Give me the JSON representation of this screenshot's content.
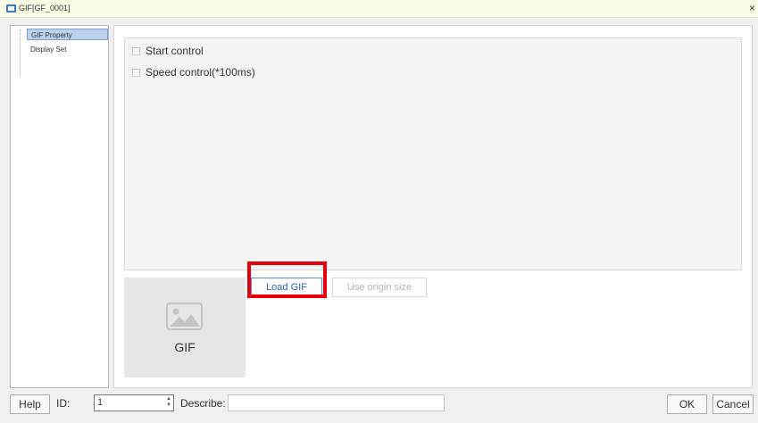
{
  "window": {
    "title": "GIF[GF_0001]",
    "close_glyph": "×"
  },
  "nav": {
    "items": [
      {
        "label": "GIF Property",
        "selected": true
      },
      {
        "label": "Display Set",
        "selected": false
      }
    ]
  },
  "options": {
    "start_control": "Start control",
    "speed_control": "Speed control(*100ms)"
  },
  "preview": {
    "label": "GIF",
    "icon": "image-icon"
  },
  "buttons": {
    "load_gif": "Load GIF",
    "use_origin_size": "Use origin size"
  },
  "footer": {
    "help": "Help",
    "id_label": "ID:",
    "id_value": "1",
    "describe_label": "Describe:",
    "describe_value": "",
    "ok": "OK",
    "cancel": "Cancel"
  },
  "colors": {
    "highlight": "#e5000b",
    "selected_item": "#b9d1ea",
    "titlebar": "#fbfbe6"
  }
}
